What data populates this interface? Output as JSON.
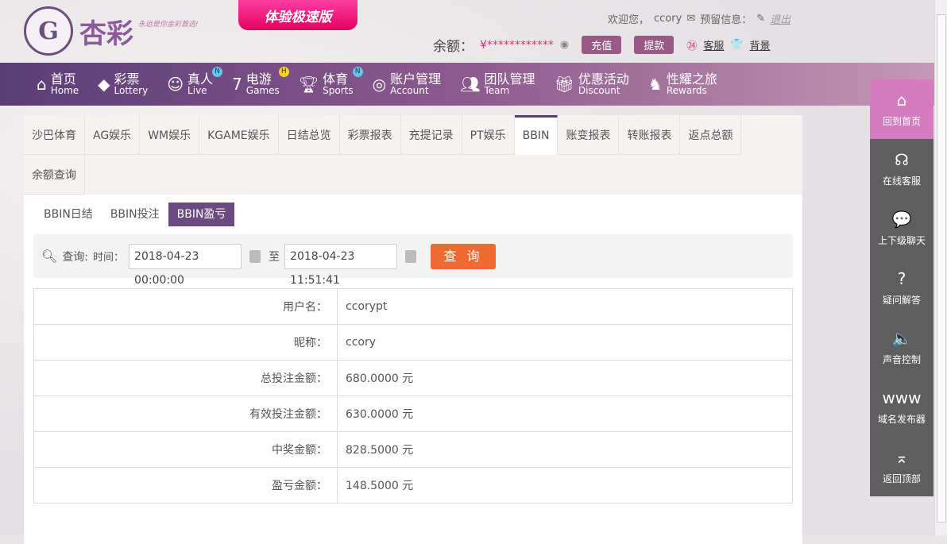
{
  "header": {
    "logo_text": "杏彩",
    "logo_slogan": "永远是你金彩首选!",
    "speed_banner": "体验极速版",
    "welcome": "欢迎您，",
    "username": "ccory",
    "messages": "预留信息：",
    "logout": "退出",
    "balance_label": "余额：",
    "balance_value": "¥************",
    "deposit": "充值",
    "withdraw": "提款",
    "service": "客服",
    "background": "背景"
  },
  "nav": [
    {
      "cn": "首页",
      "en": "Home",
      "icon": "home-icon"
    },
    {
      "cn": "彩票",
      "en": "Lottery",
      "icon": "ticket-icon"
    },
    {
      "cn": "真人",
      "en": "Live",
      "icon": "woman-icon",
      "badge": "N",
      "badge_color": "#5fc8f0"
    },
    {
      "cn": "电游",
      "en": "Games",
      "icon": "seven-icon",
      "badge": "H",
      "badge_color": "#f5d423"
    },
    {
      "cn": "体育",
      "en": "Sports",
      "icon": "trophy-icon",
      "badge": "N",
      "badge_color": "#5fc8f0"
    },
    {
      "cn": "账户管理",
      "en": "Account",
      "icon": "account-icon"
    },
    {
      "cn": "团队管理",
      "en": "Team",
      "icon": "team-icon"
    },
    {
      "cn": "优惠活动",
      "en": "Discount",
      "icon": "gift-icon"
    },
    {
      "cn": "性耀之旅",
      "en": "Rewards",
      "icon": "rewards-icon"
    }
  ],
  "tabs": [
    "沙巴体育",
    "AG娱乐",
    "WM娱乐",
    "KGAME娱乐",
    "日结总览",
    "彩票报表",
    "充提记录",
    "PT娱乐",
    "BBIN",
    "账变报表",
    "转账报表",
    "返点总额",
    "余额查询"
  ],
  "active_tab": "BBIN",
  "subtabs": [
    "BBIN日结",
    "BBIN投注",
    "BBIN盈亏"
  ],
  "active_subtab": "BBIN盈亏",
  "query": {
    "label": "查询:",
    "time_label": "时间：",
    "start": "2018-04-23 00:00:00",
    "to": "至",
    "end": "2018-04-23 11:51:41",
    "button": "查 询"
  },
  "rows": [
    {
      "k": "用户名：",
      "v": "ccorypt"
    },
    {
      "k": "昵称：",
      "v": "ccory"
    },
    {
      "k": "总投注金额：",
      "v": "680.0000 元"
    },
    {
      "k": "有效投注金额：",
      "v": "630.0000 元"
    },
    {
      "k": "中奖金额：",
      "v": "828.5000 元"
    },
    {
      "k": "盈亏金额：",
      "v": "148.5000 元"
    }
  ],
  "side": [
    {
      "label": "回到首页",
      "icon": "home-icon",
      "glyph": "⌂"
    },
    {
      "label": "在线客服",
      "icon": "headset-icon",
      "glyph": "☊"
    },
    {
      "label": "上下级聊天",
      "icon": "chat-icon",
      "glyph": "💬"
    },
    {
      "label": "疑问解答",
      "icon": "question-icon",
      "glyph": "?"
    },
    {
      "label": "声音控制",
      "icon": "speaker-icon",
      "glyph": "🔈"
    },
    {
      "label": "域名发布器",
      "icon": "www-icon",
      "glyph": "www"
    },
    {
      "label": "返回顶部",
      "icon": "top-icon",
      "glyph": "⌅"
    }
  ]
}
